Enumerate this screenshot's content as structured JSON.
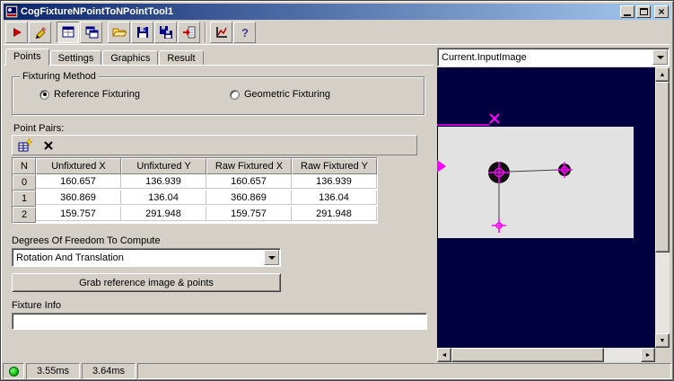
{
  "window": {
    "title": "CogFixtureNPointToNPointTool1"
  },
  "toolbar": {
    "buttons": [
      {
        "name": "run-tool",
        "icon": "play-icon"
      },
      {
        "name": "electric-run",
        "icon": "pencil-icon"
      },
      {
        "name": "show-image-pane",
        "icon": "image-window-icon",
        "pressed": true
      },
      {
        "name": "float-windows",
        "icon": "windows-icon"
      },
      {
        "name": "open-file",
        "icon": "open-folder-icon"
      },
      {
        "name": "save-file",
        "icon": "save-icon"
      },
      {
        "name": "save-copy",
        "icon": "save-copy-icon"
      },
      {
        "name": "import",
        "icon": "import-icon"
      },
      {
        "name": "results-graph",
        "icon": "graph-icon"
      },
      {
        "name": "help",
        "icon": "help-icon"
      }
    ]
  },
  "tabs": [
    {
      "label": "Points",
      "active": true
    },
    {
      "label": "Settings",
      "active": false
    },
    {
      "label": "Graphics",
      "active": false
    },
    {
      "label": "Result",
      "active": false
    }
  ],
  "fixturing": {
    "group_label": "Fixturing Method",
    "options": [
      {
        "label": "Reference Fixturing",
        "selected": true
      },
      {
        "label": "Geometric Fixturing",
        "selected": false
      }
    ]
  },
  "point_pairs": {
    "label": "Point Pairs:",
    "toolbar_icons": [
      "add-point-pair-icon",
      "delete-point-pair-icon"
    ],
    "table": {
      "headers": [
        "N",
        "Unfixtured X",
        "Unfixtured Y",
        "Raw Fixtured X",
        "Raw Fixtured Y"
      ],
      "rows": [
        [
          "0",
          "160.657",
          "136.939",
          "160.657",
          "136.939"
        ],
        [
          "1",
          "360.869",
          "136.04",
          "360.869",
          "136.04"
        ],
        [
          "2",
          "159.757",
          "291.948",
          "159.757",
          "291.948"
        ]
      ]
    }
  },
  "dof": {
    "label": "Degrees Of Freedom To Compute",
    "value": "Rotation And Translation"
  },
  "grab_button": {
    "label": "Grab reference image & points"
  },
  "fixture_info": {
    "label": "Fixture Info",
    "value": ""
  },
  "image_panel": {
    "selector_value": "Current.InputImage"
  },
  "status_bar": {
    "items": [
      "3.55ms",
      "3.64ms"
    ]
  },
  "colors": {
    "titlebar_left": "#0a246a",
    "titlebar_right": "#a6caf0",
    "image_background": "#000040",
    "marker_magenta": "#ff00ff",
    "led_green": "#00b000"
  }
}
